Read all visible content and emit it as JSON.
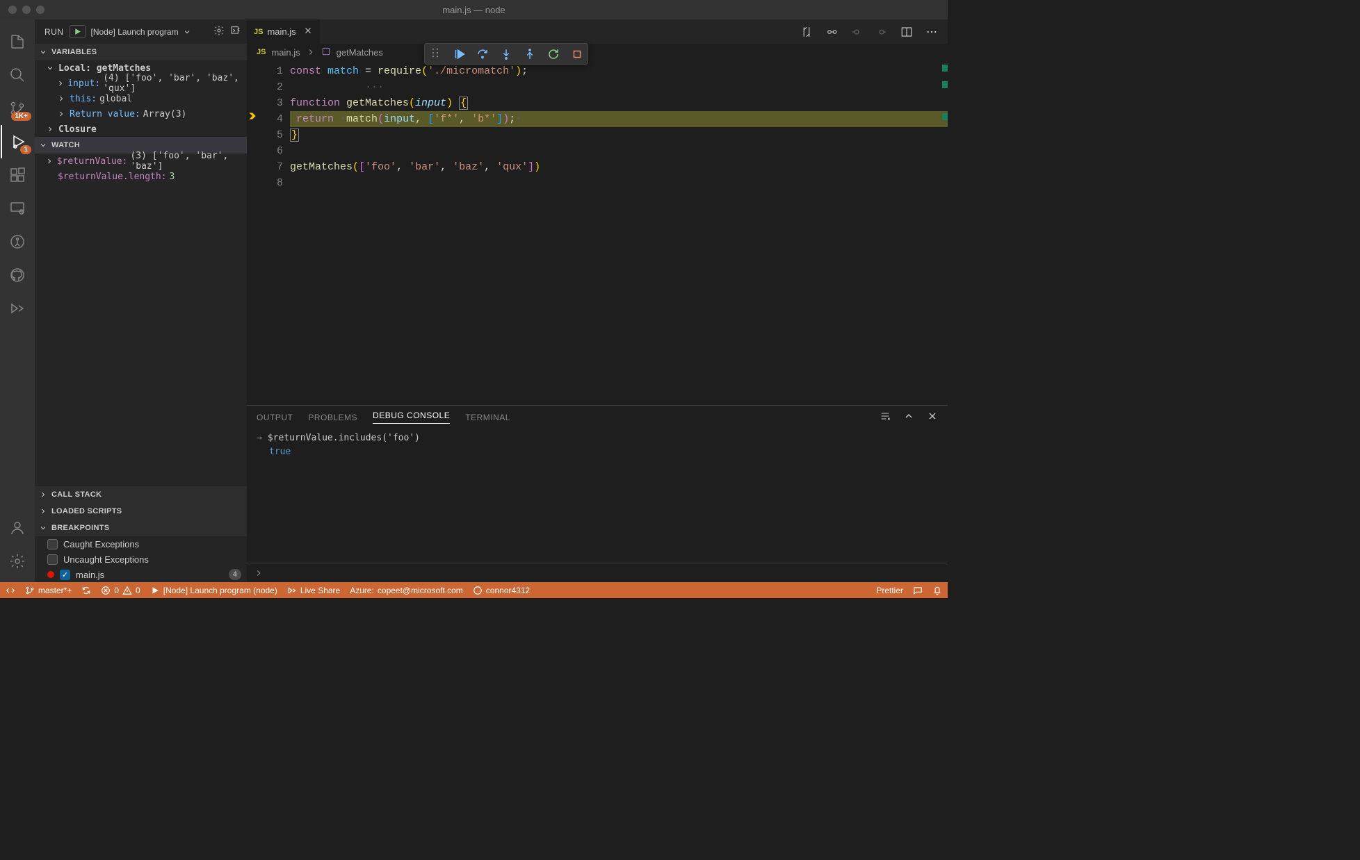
{
  "window": {
    "title": "main.js — node"
  },
  "run_header": {
    "label": "RUN",
    "config": "[Node] Launch program"
  },
  "variables": {
    "title": "VARIABLES",
    "scope": "Local: getMatches",
    "input_name": "input:",
    "input_value": "(4) ['foo', 'bar', 'baz', 'qux']",
    "this_name": "this:",
    "this_value": "global",
    "return_name": "Return value:",
    "return_value": "Array(3)",
    "closure": "Closure"
  },
  "watch": {
    "title": "WATCH",
    "rv_name": "$returnValue:",
    "rv_value": "(3) ['foo', 'bar', 'baz']",
    "len_name": "$returnValue.length:",
    "len_value": "3"
  },
  "sections": {
    "callstack": "CALL STACK",
    "loaded": "LOADED SCRIPTS",
    "breakpoints": "BREAKPOINTS"
  },
  "breakpoints": {
    "caught": "Caught Exceptions",
    "uncaught": "Uncaught Exceptions",
    "file": "main.js",
    "count": "4"
  },
  "tab": {
    "filename": "main.js"
  },
  "breadcrumb": {
    "file": "main.js",
    "fn": "getMatches"
  },
  "code": {
    "l1_pre": "const ",
    "l1_match": "match",
    "l1_eq": " = ",
    "l1_req": "require",
    "l1_p1": "(",
    "l1_s": "'./micromatch'",
    "l1_p2": ")",
    "l1_semi": ";",
    "l3_fn": "function ",
    "l3_name": "getMatches",
    "l3_p1": "(",
    "l3_param": "input",
    "l3_p2": ") ",
    "l3_b": "{",
    "l4_ret": "return ",
    "l4_m": "match",
    "l4_p1": "(",
    "l4_inp": "input",
    "l4_c": ", ",
    "l4_b1": "[",
    "l4_s1": "'f*'",
    "l4_c2": ", ",
    "l4_s2": "'b*'",
    "l4_b2": "]",
    "l4_p2": ")",
    "l4_semi": ";",
    "l5_b": "}",
    "l7_fn": "getMatches",
    "l7_p1": "(",
    "l7_b1": "[",
    "l7_s1": "'foo'",
    "l7_s2": "'bar'",
    "l7_s3": "'baz'",
    "l7_s4": "'qux'",
    "l7_b2": "]",
    "l7_p2": ")"
  },
  "line_numbers": [
    "1",
    "2",
    "3",
    "4",
    "5",
    "6",
    "7",
    "8"
  ],
  "panel": {
    "output": "OUTPUT",
    "problems": "PROBLEMS",
    "debug": "DEBUG CONSOLE",
    "terminal": "TERMINAL"
  },
  "console": {
    "expr": "$returnValue.includes('foo')",
    "result": "true"
  },
  "status": {
    "branch": "master*+",
    "errors": "0",
    "warnings": "0",
    "launch": "[Node] Launch program (node)",
    "liveshare": "Live Share",
    "azure_label": "Azure: ",
    "azure": "copeet@microsoft.com",
    "user": "connor4312",
    "prettier": "Prettier"
  },
  "badges": {
    "scm": "1K+",
    "debug": "1"
  }
}
